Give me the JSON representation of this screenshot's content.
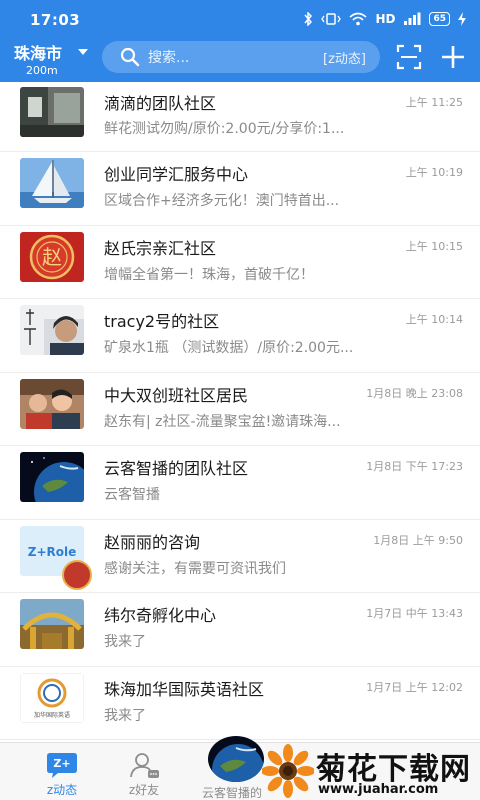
{
  "status_bar": {
    "time": "17:03",
    "network": "HD",
    "battery": "65"
  },
  "top_bar": {
    "city": "珠海市",
    "distance": "200m",
    "search_placeholder": "搜索...",
    "search_tag": "[z动态]",
    "icons": [
      "scan-icon",
      "plus-icon"
    ]
  },
  "conversations": [
    {
      "title": "滴滴的团队社区",
      "time": "上午 11:25",
      "preview": "鲜花测试勿购/原价:2.00元/分享价:1..."
    },
    {
      "title": "创业同学汇服务中心",
      "time": "上午 10:19",
      "preview": "区域合作+经济多元化！澳门特首出..."
    },
    {
      "title": "赵氏宗亲汇社区",
      "time": "上午 10:15",
      "preview": "增幅全省第一！珠海，首破千亿！"
    },
    {
      "title": "tracy2号的社区",
      "time": "上午 10:14",
      "preview": "矿泉水1瓶 （测试数据）/原价:2.00元..."
    },
    {
      "title": "中大双创班社区居民",
      "time": "1月8日 晚上 23:08",
      "preview": "赵东有| z社区-流量聚宝盆!邀请珠海..."
    },
    {
      "title": "云客智播的团队社区",
      "time": "1月8日 下午 17:23",
      "preview": "云客智播"
    },
    {
      "title": "赵丽丽的咨询",
      "time": "1月8日 上午 9:50",
      "preview": "感谢关注，有需要可资讯我们"
    },
    {
      "title": "纬尔奇孵化中心",
      "time": "1月7日 中午 13:43",
      "preview": "我来了"
    },
    {
      "title": "珠海加华国际英语社区",
      "time": "1月7日 上午 12:02",
      "preview": "我来了"
    }
  ],
  "avatar_text": {
    "zhao": "赵",
    "zrole": "Z+Role",
    "jiahua_label": "加华国际英语"
  },
  "bottom_nav": {
    "items": [
      {
        "label": "z动态",
        "active": true
      },
      {
        "label": "z好友",
        "active": false
      },
      {
        "label": "云客智播的",
        "active": false
      }
    ],
    "z_icon_text": "Z+"
  },
  "watermark": {
    "title": "菊花下载网",
    "url": "www.juahar.com"
  },
  "colors": {
    "brand_blue": "#2f86e6",
    "search_bg": "#5aa0ee",
    "title_text": "#1a1a1a",
    "preview_text": "#8a8a8a",
    "time_text": "#9b9b9b"
  }
}
